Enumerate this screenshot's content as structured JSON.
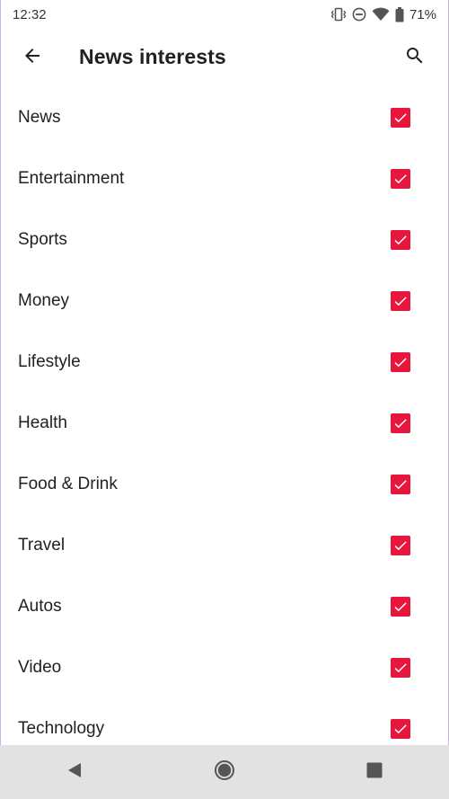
{
  "status_bar": {
    "time": "12:32",
    "battery_percent": "71%",
    "icons": [
      "vibrate-icon",
      "do-not-disturb-icon",
      "wifi-icon",
      "battery-icon"
    ]
  },
  "app_bar": {
    "title": "News interests",
    "back_icon": "arrow-back-icon",
    "search_icon": "search-icon"
  },
  "accent_color": "#e8163c",
  "interests": [
    {
      "label": "News",
      "checked": true
    },
    {
      "label": "Entertainment",
      "checked": true
    },
    {
      "label": "Sports",
      "checked": true
    },
    {
      "label": "Money",
      "checked": true
    },
    {
      "label": "Lifestyle",
      "checked": true
    },
    {
      "label": "Health",
      "checked": true
    },
    {
      "label": "Food & Drink",
      "checked": true
    },
    {
      "label": "Travel",
      "checked": true
    },
    {
      "label": "Autos",
      "checked": true
    },
    {
      "label": "Video",
      "checked": true
    },
    {
      "label": "Technology",
      "checked": true
    }
  ],
  "nav_bar": {
    "buttons": [
      "back-triangle-icon",
      "home-circle-icon",
      "recents-square-icon"
    ]
  }
}
